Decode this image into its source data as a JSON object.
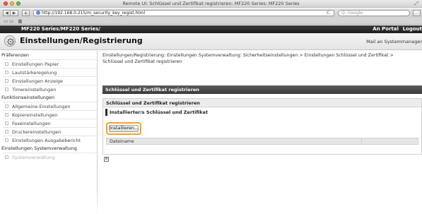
{
  "browser": {
    "window_title": "Remote UI: Schlüssel und Zertifikat registrieren: MF220 Series: MF220 Series",
    "url": "http://192.168.0.215/m_security_key_regist.html",
    "search_placeholder": "Q- Google",
    "icons": [
      "back-icon",
      "forward-icon",
      "add-icon",
      "globe-icon",
      "reload-icon",
      "search-icon",
      "reading-list-icon",
      "top-sites-icon",
      "grid-icon"
    ]
  },
  "header": {
    "product": "MF220 Series/MF220 Series/",
    "portal_link": "An Portal",
    "logout_link": "Logout"
  },
  "title_area": {
    "title": "Einstellungen/Registrierung",
    "mail_link": "Mail an Systemmanager"
  },
  "sidebar": {
    "section_preferences": "Präferenzen",
    "preference_items": [
      {
        "label": "Einstellungen Papier"
      },
      {
        "label": "Lautstärkeregelung"
      },
      {
        "label": "Einstellungen Anzeige"
      },
      {
        "label": "Timereinstellungen"
      }
    ],
    "section_functions": "Funktionseinstellungen",
    "function_items": [
      {
        "label": "Allgemeine Einstellungen"
      },
      {
        "label": "Kopiereinstellungen"
      },
      {
        "label": "Faxeinstellungen"
      },
      {
        "label": "Druckereinstellungen"
      },
      {
        "label": "Einstellungen Ausgabebericht"
      }
    ],
    "section_system": "Einstellungen Systemverwaltung",
    "system_items": [
      {
        "label": "Systemverwaltung"
      }
    ]
  },
  "main": {
    "breadcrumb": "Einstellungen/Registrierung: Einstellungen Systemverwaltung: Sicherheitseinstellungen > Einstellungen Schlüssel und Zertifikat > Schlüssel und Zertifikat registrieren",
    "section_title": "Schlüssel und Zertifikat registrieren",
    "panel_title": "Schlüssel und Zertifikat registrieren",
    "subsection_title": "Installierter/s Schlüssel und Zertifikat",
    "install_button": "Installieren...",
    "table_header_filename": "Dateiname"
  },
  "colors": {
    "header_bg": "#2a2a2a",
    "section_bar_bg": "#4a4a4a",
    "highlight_ring": "#f3a428"
  }
}
